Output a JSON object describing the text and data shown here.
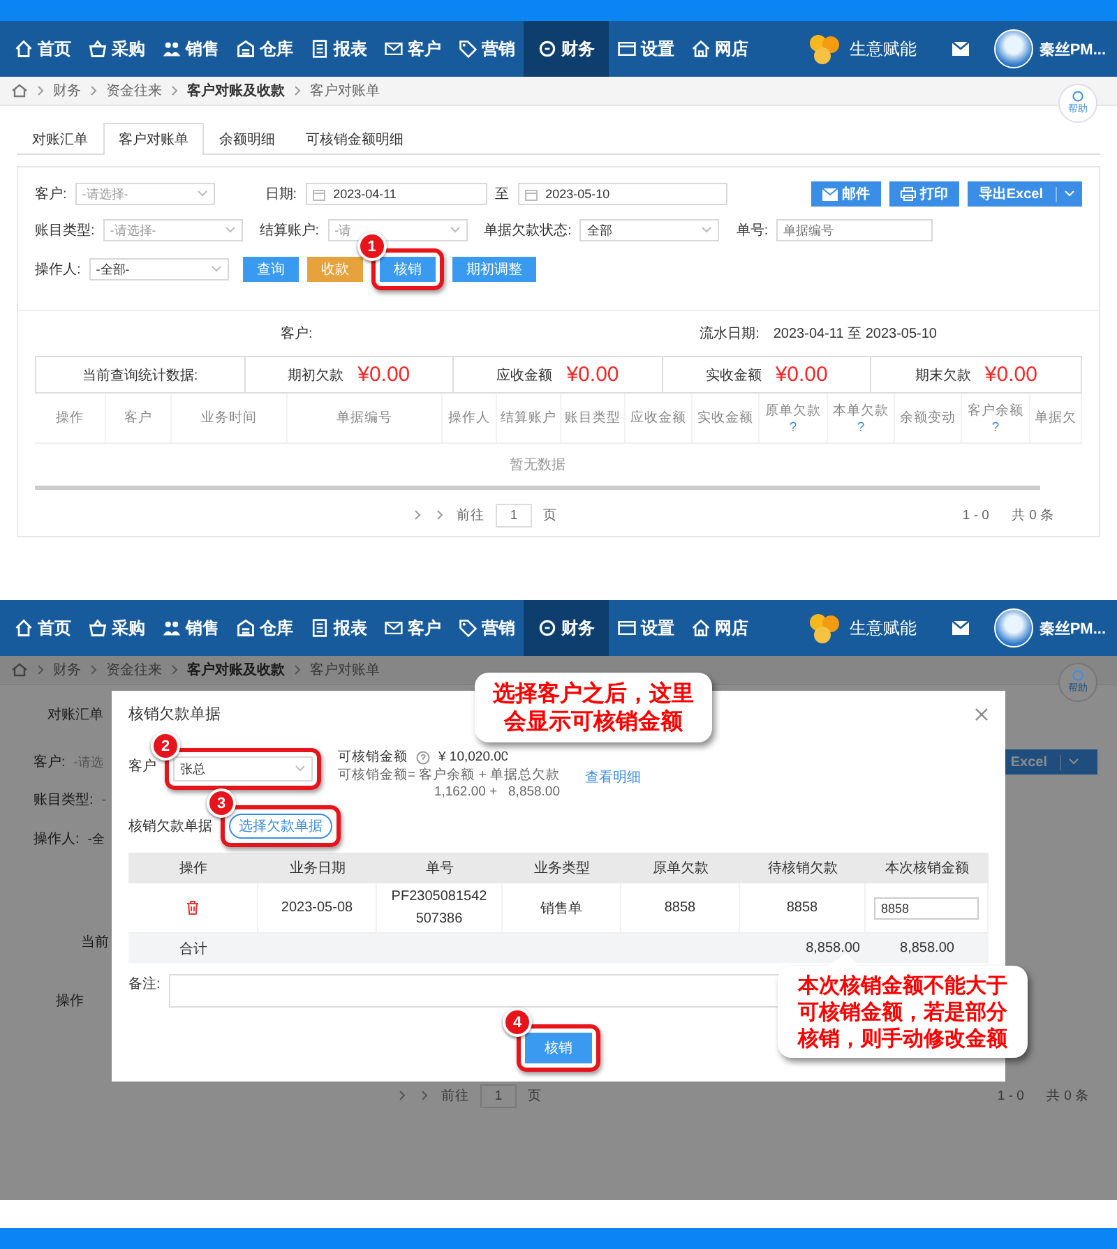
{
  "screen_1": {
    "nav": {
      "items": [
        {
          "label": "首页",
          "selected": false
        },
        {
          "label": "采购",
          "selected": false
        },
        {
          "label": "销售",
          "selected": false
        },
        {
          "label": "仓库",
          "selected": false
        },
        {
          "label": "报表",
          "selected": false
        },
        {
          "label": "客户",
          "selected": false
        },
        {
          "label": "营销",
          "selected": false
        },
        {
          "label": "财务",
          "selected": true
        },
        {
          "label": "设置",
          "selected": false
        },
        {
          "label": "网店",
          "selected": false
        }
      ],
      "brand": "生意赋能",
      "user": "秦丝PM..."
    },
    "breadcrumb": [
      {
        "label": "财务",
        "bold": false
      },
      {
        "label": "资金往来",
        "bold": false
      },
      {
        "label": "客户对账及收款",
        "bold": true
      },
      {
        "label": "客户对账单",
        "bold": false
      }
    ],
    "help": "帮助",
    "tabs": [
      {
        "label": "对账汇单",
        "selected": false
      },
      {
        "label": "客户对账单",
        "selected": true
      },
      {
        "label": "余额明细",
        "selected": false
      },
      {
        "label": "可核销金额明细",
        "selected": false
      }
    ],
    "filters": {
      "customer": {
        "label": "客户:",
        "placeholder": "-请选择-"
      },
      "date": {
        "label": "日期:",
        "from": "2023-04-11",
        "separator": "至",
        "to": "2023-05-10"
      },
      "tools": [
        {
          "label": "邮件"
        },
        {
          "label": "打印"
        },
        {
          "label": "导出Excel"
        }
      ],
      "account_type": {
        "label": "账目类型:",
        "placeholder": "-请选择-"
      },
      "settlement": {
        "label": "结算账户:",
        "placeholder": "-请"
      },
      "status": {
        "label": "单据欠款状态:",
        "value": "全部"
      },
      "number": {
        "label": "单号:",
        "placeholder": "单据编号"
      },
      "operator": {
        "label": "操作人:",
        "value": "-全部-"
      },
      "actions": [
        {
          "label": "查询",
          "kind": "primary",
          "highlighted": false
        },
        {
          "label": "收款",
          "kind": "warning",
          "highlighted": false
        },
        {
          "label": "核销",
          "kind": "primary",
          "highlighted": true,
          "step": "1"
        },
        {
          "label": "期初调整",
          "kind": "primary",
          "highlighted": false
        }
      ]
    },
    "summary": {
      "customer_label": "客户:",
      "period_label": "流水日期:",
      "period": "2023-04-11 至 2023-05-10"
    },
    "stats": {
      "label": "当前查询统计数据:",
      "items": [
        {
          "label": "期初欠款",
          "value": "¥0.00"
        },
        {
          "label": "应收金额",
          "value": "¥0.00"
        },
        {
          "label": "实收金额",
          "value": "¥0.00"
        },
        {
          "label": "期末欠款",
          "value": "¥0.00"
        }
      ]
    },
    "table": {
      "columns": [
        {
          "label": "操作"
        },
        {
          "label": "客户"
        },
        {
          "label": "业务时间"
        },
        {
          "label": "单据编号"
        },
        {
          "label": "操作人"
        },
        {
          "label": "结算账户"
        },
        {
          "label": "账目类型"
        },
        {
          "label": "应收金额"
        },
        {
          "label": "实收金额"
        },
        {
          "label": "原单欠款",
          "hint": "?"
        },
        {
          "label": "本单欠款",
          "hint": "?"
        },
        {
          "label": "余额变动"
        },
        {
          "label": "客户余额",
          "hint": "?"
        },
        {
          "label": "单据欠"
        }
      ],
      "empty_text": "暂无数据"
    },
    "pagination": {
      "prefix": "前往",
      "page": "1",
      "suffix": "页",
      "range": "1 - 0",
      "total": "共 0 条"
    }
  },
  "screen_2": {
    "nav": {
      "items": [
        {
          "label": "首页",
          "selected": false
        },
        {
          "label": "采购",
          "selected": false
        },
        {
          "label": "销售",
          "selected": false
        },
        {
          "label": "仓库",
          "selected": false
        },
        {
          "label": "报表",
          "selected": false
        },
        {
          "label": "客户",
          "selected": false
        },
        {
          "label": "营销",
          "selected": false
        },
        {
          "label": "财务",
          "selected": true
        },
        {
          "label": "设置",
          "selected": false
        },
        {
          "label": "网店",
          "selected": false
        }
      ],
      "brand": "生意赋能",
      "user": "秦丝PM..."
    },
    "breadcrumb": [
      {
        "label": "财务",
        "bold": false
      },
      {
        "label": "资金往来",
        "bold": false
      },
      {
        "label": "客户对账及收款",
        "bold": true
      },
      {
        "label": "客户对账单",
        "bold": false
      }
    ],
    "help": "帮助",
    "background": {
      "tab": "对账汇单",
      "labels": [
        {
          "label": "客户:",
          "placeholder": "-请选"
        },
        {
          "label": "账目类型:",
          "placeholder": "-"
        },
        {
          "label": "操作人:",
          "value": "-全"
        }
      ],
      "export": "Excel",
      "stats_label": "当前",
      "column": "操作",
      "pagination": {
        "prefix": "前往",
        "page": "1",
        "suffix": "页",
        "range": "1 - 0",
        "total": "共 0 条"
      }
    },
    "dialog": {
      "title": "核销欠款单据",
      "customer": {
        "label": "客户",
        "value": "张总",
        "highlighted": true,
        "step": "2"
      },
      "available": {
        "label": "可核销金额",
        "amount": "¥ 10,020.00",
        "link": "查看明细",
        "formula": "可核销金额= 客户余额 + 单据总欠款",
        "values": "1,162.00 +   8,858.00"
      },
      "select_label": "核销欠款单据",
      "select_button": {
        "label": "选择欠款单据",
        "highlighted": true,
        "step": "3"
      },
      "columns": [
        "操作",
        "业务日期",
        "单号",
        "业务类型",
        "原单欠款",
        "待核销欠款",
        "本次核销金额"
      ],
      "rows": [
        {
          "date": "2023-05-08",
          "number": "PF2305081542507386",
          "type": "销售单",
          "original": "8858",
          "pending": "8858",
          "amount": "8858"
        }
      ],
      "total": {
        "label": "合计",
        "pending": "8,858.00",
        "amount": "8,858.00"
      },
      "note_label": "备注:",
      "submit": {
        "label": "核销",
        "highlighted": true,
        "step": "4"
      }
    },
    "callouts": [
      "选择客户之后，这里会显示可核销金额",
      "本次核销金额不能大于可核销金额，若是部分核销，则手动修改金额"
    ]
  }
}
